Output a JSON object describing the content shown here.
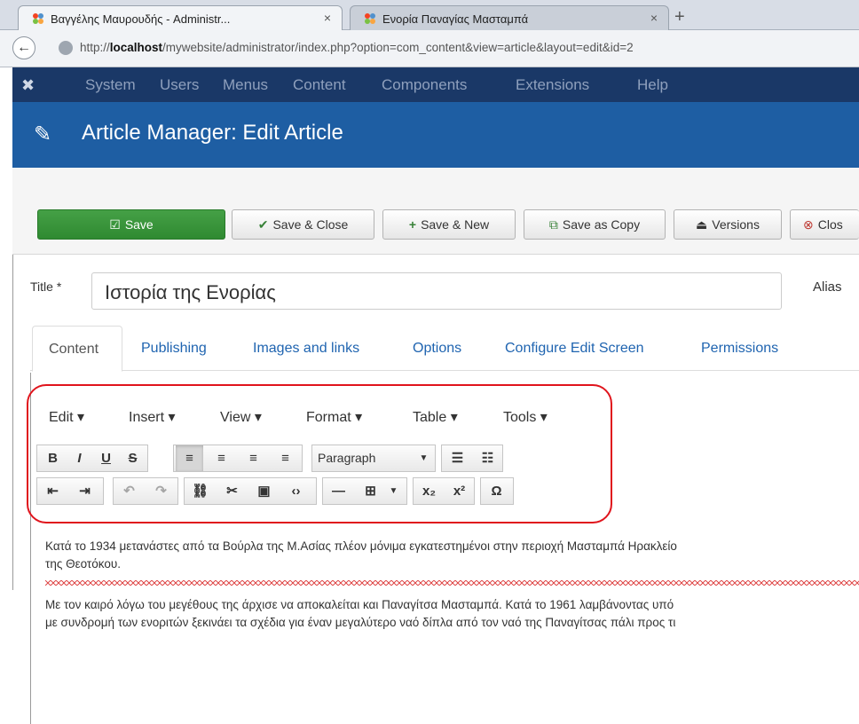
{
  "browser": {
    "tabs": [
      {
        "title": "Βαγγέλης Μαυρουδής - Administr...",
        "close": "×"
      },
      {
        "title": "Ενορία Παναγίας Μασταμπά",
        "close": "×"
      }
    ],
    "new_tab": "+",
    "url_host_prefix": "http://",
    "url_host": "localhost",
    "url_rest": "/mywebsite/administrator/index.php?option=com_content&view=article&layout=edit&id=2"
  },
  "admin_menu": [
    "System",
    "Users",
    "Menus",
    "Content",
    "Components",
    "Extensions",
    "Help"
  ],
  "header": {
    "title": "Article Manager: Edit Article"
  },
  "toolbar": {
    "save": "Save",
    "save_close": "Save & Close",
    "save_new": "Save & New",
    "save_copy": "Save as Copy",
    "versions": "Versions",
    "close": "Clos"
  },
  "form": {
    "title_label": "Title *",
    "title_value": "Ιστορία της Ενορίας",
    "alias_label": "Alias"
  },
  "content_tabs": [
    "Content",
    "Publishing",
    "Images and links",
    "Options",
    "Configure Edit Screen",
    "Permissions"
  ],
  "editor": {
    "menus": [
      "Edit ▾",
      "Insert ▾",
      "View ▾",
      "Format ▾",
      "Table ▾",
      "Tools ▾"
    ],
    "paragraph": "Paragraph",
    "text_lines": [
      "Κατά το 1934 μετανάστες από τα Βούρλα της Μ.Ασίας πλέον μόνιμα εγκατεστημένοι στην περιοχή Μασταμπά Ηρακλείο",
      "της Θεοτόκου.",
      "Με τον καιρό λόγω του μεγέθους της άρχισε να αποκαλείται και Παναγίτσα Μασταμπά. Κατά το 1961 λαμβάνοντας υπό",
      "με συνδρομή των ενοριτών ξεκινάει τα σχέδια για έναν μεγαλύτερο ναό δίπλα από τον ναό της Παναγίτσας πάλι προς τι"
    ]
  }
}
